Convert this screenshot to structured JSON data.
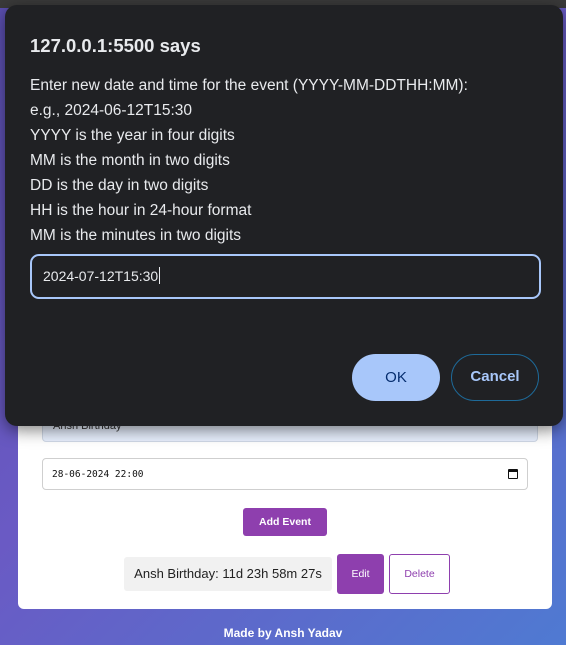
{
  "app": {
    "name_input_value": "Ansh Birthday",
    "date_input_value": "28-06-2024 22:00",
    "add_button_label": "Add Event",
    "event": {
      "text": "Ansh Birthday: 11d 23h 58m 27s",
      "edit_label": "Edit",
      "delete_label": "Delete"
    },
    "footer": "Made by Ansh Yadav"
  },
  "dialog": {
    "title": "127.0.0.1:5500 says",
    "lines": [
      "Enter new date and time for the event (YYYY-MM-DDTHH:MM):",
      "e.g., 2024-06-12T15:30",
      "YYYY is the year in four digits",
      "MM is the month in two digits",
      "DD is the day in two digits",
      "HH is the hour in 24-hour format",
      "MM is the minutes in two digits"
    ],
    "input_value": "2024-07-12T15:30",
    "ok_label": "OK",
    "cancel_label": "Cancel"
  },
  "colors": {
    "accent": "#8e3fae",
    "dialog_bg": "#202124",
    "dialog_button": "#a8c7fa"
  }
}
